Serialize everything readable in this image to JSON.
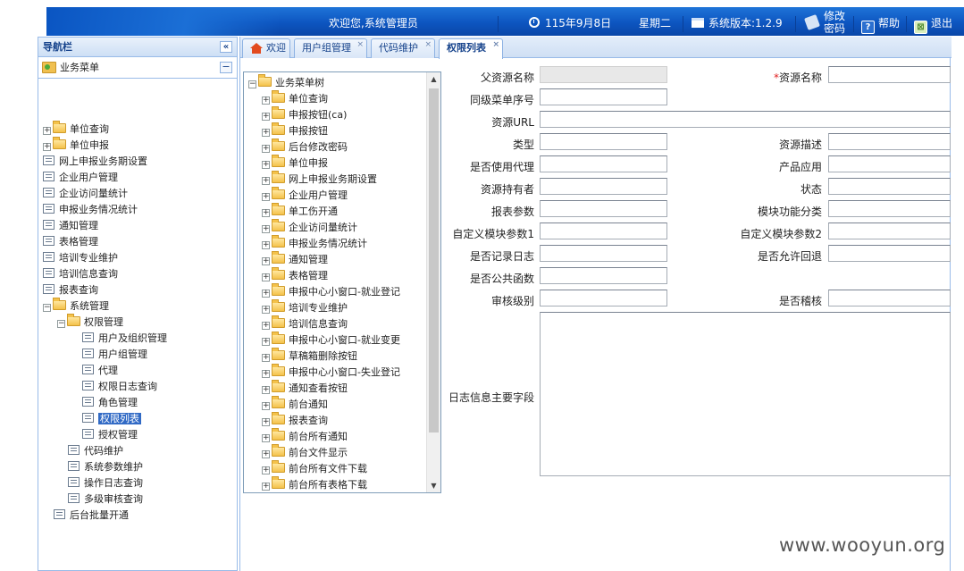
{
  "header": {
    "welcome": "欢迎您,系统管理员",
    "date": "115年9月8日",
    "weekday": "星期二",
    "version": "系统版本:1.2.9",
    "change_password_line1": "修改",
    "change_password_line2": "密码",
    "help": "帮助",
    "exit": "退出"
  },
  "nav": {
    "title": "导航栏",
    "collapse_symbol": "«",
    "section": "业务菜单",
    "section_symbol": "−",
    "items": [
      {
        "label": "单位查询"
      },
      {
        "label": "单位申报"
      },
      {
        "label": "网上申报业务期设置"
      },
      {
        "label": "企业用户管理"
      },
      {
        "label": "企业访问量统计"
      },
      {
        "label": "申报业务情况统计"
      },
      {
        "label": "通知管理"
      },
      {
        "label": "表格管理"
      },
      {
        "label": "培训专业维护"
      },
      {
        "label": "培训信息查询"
      },
      {
        "label": "报表查询"
      },
      {
        "label": "系统管理"
      },
      {
        "label": "权限管理"
      },
      {
        "label": "用户及组织管理"
      },
      {
        "label": "用户组管理"
      },
      {
        "label": "代理"
      },
      {
        "label": "权限日志查询"
      },
      {
        "label": "角色管理"
      },
      {
        "label": "权限列表"
      },
      {
        "label": "授权管理"
      },
      {
        "label": "代码维护"
      },
      {
        "label": "系统参数维护"
      },
      {
        "label": "操作日志查询"
      },
      {
        "label": "多级审核查询"
      },
      {
        "label": "后台批量开通"
      }
    ]
  },
  "tabs": [
    {
      "label": "欢迎"
    },
    {
      "label": "用户组管理"
    },
    {
      "label": "代码维护"
    },
    {
      "label": "权限列表"
    }
  ],
  "tab_close_symbol": "×",
  "menutree": {
    "root": "业务菜单树",
    "items": [
      "单位查询",
      "申报按钮(ca)",
      "申报按钮",
      "后台修改密码",
      "单位申报",
      "网上申报业务期设置",
      "企业用户管理",
      "单工伤开通",
      "企业访问量统计",
      "申报业务情况统计",
      "通知管理",
      "表格管理",
      "申报中心小窗口-就业登记",
      "培训专业维护",
      "培训信息查询",
      "申报中心小窗口-就业变更",
      "草稿箱删除按钮",
      "申报中心小窗口-失业登记",
      "通知查看按钮",
      "前台通知",
      "报表查询",
      "前台所有通知",
      "前台文件显示",
      "前台所有文件下载",
      "前台所有表格下载"
    ],
    "scroll_up": "▲",
    "scroll_down": "▼"
  },
  "form": {
    "parent_name": "父资源名称",
    "resource_name": "资源名称",
    "required_mark": "*",
    "sibling_order": "同级菜单序号",
    "resource_url": "资源URL",
    "type": "类型",
    "resource_desc": "资源描述",
    "use_proxy": "是否使用代理",
    "product_app": "产品应用",
    "owner": "资源持有者",
    "status": "状态",
    "report_param": "报表参数",
    "module_category": "模块功能分类",
    "custom_param1": "自定义模块参数1",
    "custom_param2": "自定义模块参数2",
    "record_log": "是否记录日志",
    "allow_rollback": "是否允许回退",
    "public_function": "是否公共函数",
    "review_level": "审核级别",
    "audit": "是否稽核",
    "log_main_field": "日志信息主要字段"
  },
  "watermark": "www.wooyun.org"
}
